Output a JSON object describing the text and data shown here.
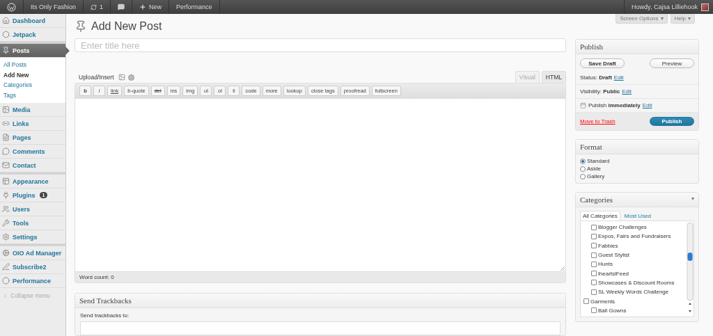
{
  "admin_bar": {
    "site": "Its Only Fashion",
    "updates": "1",
    "new": "New",
    "items": [
      "Performance"
    ],
    "greeting": "Howdy, Cajsa Lilliehook"
  },
  "screen_tabs": [
    {
      "label": "Screen Options",
      "caret": "▾"
    },
    {
      "label": "Help",
      "caret": "▾"
    }
  ],
  "sidebar": {
    "sections": [
      {
        "items": [
          {
            "label": "Dashboard",
            "selected": false
          },
          {
            "label": "Jetpack",
            "selected": false
          }
        ]
      },
      {
        "items": [
          {
            "label": "Posts",
            "selected": true,
            "children": [
              {
                "label": "All Posts",
                "selected": false
              },
              {
                "label": "Add New",
                "selected": true
              },
              {
                "label": "Categories",
                "selected": false
              },
              {
                "label": "Tags",
                "selected": false
              }
            ]
          },
          {
            "label": "Media",
            "selected": false
          },
          {
            "label": "Links",
            "selected": false
          },
          {
            "label": "Pages",
            "selected": false
          },
          {
            "label": "Comments",
            "selected": false
          },
          {
            "label": "Contact",
            "selected": false
          }
        ]
      },
      {
        "items": [
          {
            "label": "Appearance",
            "selected": false
          },
          {
            "label": "Plugins",
            "selected": false,
            "badge": "1"
          },
          {
            "label": "Users",
            "selected": false
          },
          {
            "label": "Tools",
            "selected": false
          },
          {
            "label": "Settings",
            "selected": false
          }
        ]
      },
      {
        "items": [
          {
            "label": "OIO Ad Manager",
            "selected": false
          },
          {
            "label": "Subscribe2",
            "selected": false
          },
          {
            "label": "Performance",
            "selected": false
          }
        ]
      }
    ],
    "collapse": "Collapse menu"
  },
  "page_title": "Add New Post",
  "title_field": {
    "placeholder": "Enter title here"
  },
  "editor": {
    "upload_label": "Upload/Insert",
    "tabs": [
      {
        "label": "Visual",
        "selected": false
      },
      {
        "label": "HTML",
        "selected": true
      }
    ],
    "buttons": [
      {
        "label": "b",
        "kind": "bold"
      },
      {
        "label": "i",
        "kind": "italic"
      },
      {
        "label": "link",
        "kind": "link"
      },
      {
        "label": "b-quote",
        "kind": "plain"
      },
      {
        "label": "del",
        "kind": "strike"
      },
      {
        "label": "ins",
        "kind": "plain"
      },
      {
        "label": "img",
        "kind": "plain"
      },
      {
        "label": "ul",
        "kind": "plain"
      },
      {
        "label": "ol",
        "kind": "plain"
      },
      {
        "label": "li",
        "kind": "plain"
      },
      {
        "label": "code",
        "kind": "plain"
      },
      {
        "label": "more",
        "kind": "plain"
      },
      {
        "label": "lookup",
        "kind": "plain"
      },
      {
        "label": "close tags",
        "kind": "plain"
      },
      {
        "label": "proofread",
        "kind": "plain"
      },
      {
        "label": "fullscreen",
        "kind": "plain"
      }
    ],
    "word_count": "Word count: 0"
  },
  "trackbacks": {
    "title": "Send Trackbacks",
    "label": "Send trackbacks to:"
  },
  "publish": {
    "title": "Publish",
    "save_draft": "Save Draft",
    "preview": "Preview",
    "rows": [
      {
        "text": "Status: **Draft**",
        "link": "Edit",
        "kind": "plain"
      },
      {
        "text": "Visibility: **Public**",
        "link": "Edit",
        "kind": "plain"
      },
      {
        "text": "Publish **immediately**",
        "link": "Edit",
        "kind": "calendar"
      }
    ],
    "trash": "Move to Trash",
    "publish": "Publish"
  },
  "format": {
    "title": "Format",
    "options": [
      {
        "label": "Standard",
        "selected": true
      },
      {
        "label": "Aside",
        "selected": false
      },
      {
        "label": "Gallery",
        "selected": false
      }
    ]
  },
  "categories": {
    "title": "Categories",
    "toggle": "▾",
    "tabs": [
      {
        "label": "All Categories",
        "selected": true
      },
      {
        "label": "Most Used",
        "selected": false
      }
    ],
    "items": [
      {
        "children": [
          {
            "label": "Blogger Challenges",
            "checked": false
          },
          {
            "label": "Expos, Fairs and Fundraisers",
            "checked": false
          },
          {
            "label": "Fabbies",
            "checked": false
          },
          {
            "label": "Guest Stylist",
            "checked": false
          },
          {
            "label": "Hunts",
            "checked": false
          },
          {
            "label": "iheartslFeed",
            "checked": false
          },
          {
            "label": "Showcases & Discount Rooms",
            "checked": false
          },
          {
            "label": "SL Weekly Words Challenge",
            "checked": false
          }
        ]
      },
      {
        "label": "Garments",
        "checked": false,
        "children": [
          {
            "label": "Ball Gowns",
            "checked": false
          }
        ]
      }
    ]
  }
}
